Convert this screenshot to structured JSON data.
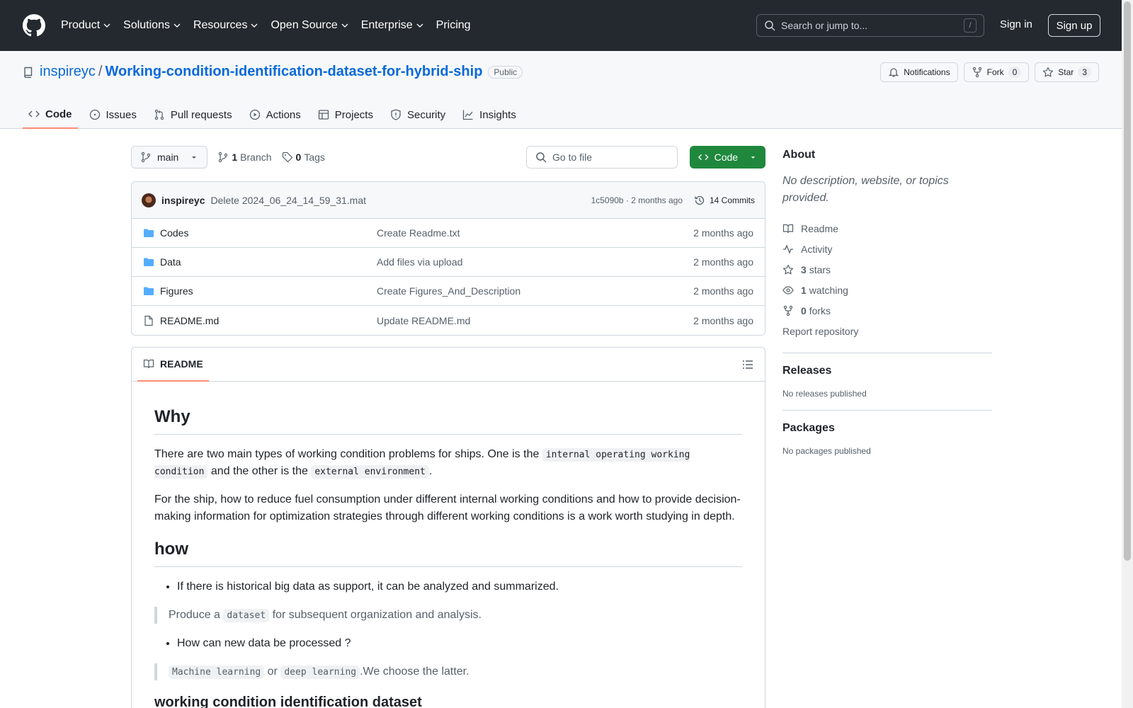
{
  "header": {
    "nav": [
      "Product",
      "Solutions",
      "Resources",
      "Open Source",
      "Enterprise",
      "Pricing"
    ],
    "search_placeholder": "Search or jump to...",
    "search_shortcut": "/",
    "signin": "Sign in",
    "signup": "Sign up"
  },
  "repo": {
    "owner": "inspireyc",
    "separator": "/",
    "name": "Working-condition-identification-dataset-for-hybrid-ship",
    "visibility": "Public",
    "notifications_label": "Notifications",
    "fork_label": "Fork",
    "fork_count": "0",
    "star_label": "Star",
    "star_count": "3"
  },
  "tabs": [
    "Code",
    "Issues",
    "Pull requests",
    "Actions",
    "Projects",
    "Security",
    "Insights"
  ],
  "toolbar": {
    "branch": "main",
    "branches_count": "1",
    "branches_label": "Branch",
    "tags_count": "0",
    "tags_label": "Tags",
    "goto_file": "Go to file",
    "code_button": "Code"
  },
  "commit": {
    "author": "inspireyc",
    "message": "Delete 2024_06_24_14_59_31.mat",
    "meta": "1c5090b · 2 months ago",
    "commits_label": "14 Commits"
  },
  "files": [
    {
      "name": "Codes",
      "type": "folder",
      "commit": "Create Readme.txt",
      "date": "2 months ago"
    },
    {
      "name": "Data",
      "type": "folder",
      "commit": "Add files via upload",
      "date": "2 months ago"
    },
    {
      "name": "Figures",
      "type": "folder",
      "commit": "Create Figures_And_Description",
      "date": "2 months ago"
    },
    {
      "name": "README.md",
      "type": "file",
      "commit": "Update README.md",
      "date": "2 months ago"
    }
  ],
  "readme": {
    "tab": "README",
    "h_why": "Why",
    "p1_a": "There are two main types of working condition problems for ships. One is the ",
    "p1_code1": "internal operating working condition",
    "p1_b": " and the other is the ",
    "p1_code2": "external environment",
    "p1_c": ".",
    "p2": "For the ship, how to reduce fuel consumption under different internal working conditions and how to provide decision-making information for optimization strategies through different working conditions is a work worth studying in depth.",
    "h_how": "how",
    "li1": "If there is historical big data as support, it can be analyzed and summarized.",
    "bq1_a": "Produce a ",
    "bq1_code": "dataset",
    "bq1_b": " for subsequent organization and analysis.",
    "li2": "How can new data be processed ?",
    "bq2_code1": "Machine learning",
    "bq2_or": " or ",
    "bq2_code2": "deep learning",
    "bq2_b": ".We choose the latter.",
    "h3": "working condition identification dataset"
  },
  "sidebar": {
    "about_title": "About",
    "about_desc": "No description, website, or topics provided.",
    "readme": "Readme",
    "activity": "Activity",
    "stars_count": "3",
    "stars_label": "stars",
    "watching_count": "1",
    "watching_label": "watching",
    "forks_count": "0",
    "forks_label": "forks",
    "report": "Report repository",
    "releases_title": "Releases",
    "releases_desc": "No releases published",
    "packages_title": "Packages",
    "packages_desc": "No packages published"
  },
  "colors": {
    "header_bg": "#24292f",
    "link_blue": "#0969da",
    "code_green": "#1f883d",
    "tab_underline": "#fd8c73",
    "folder_blue": "#54aeff"
  }
}
